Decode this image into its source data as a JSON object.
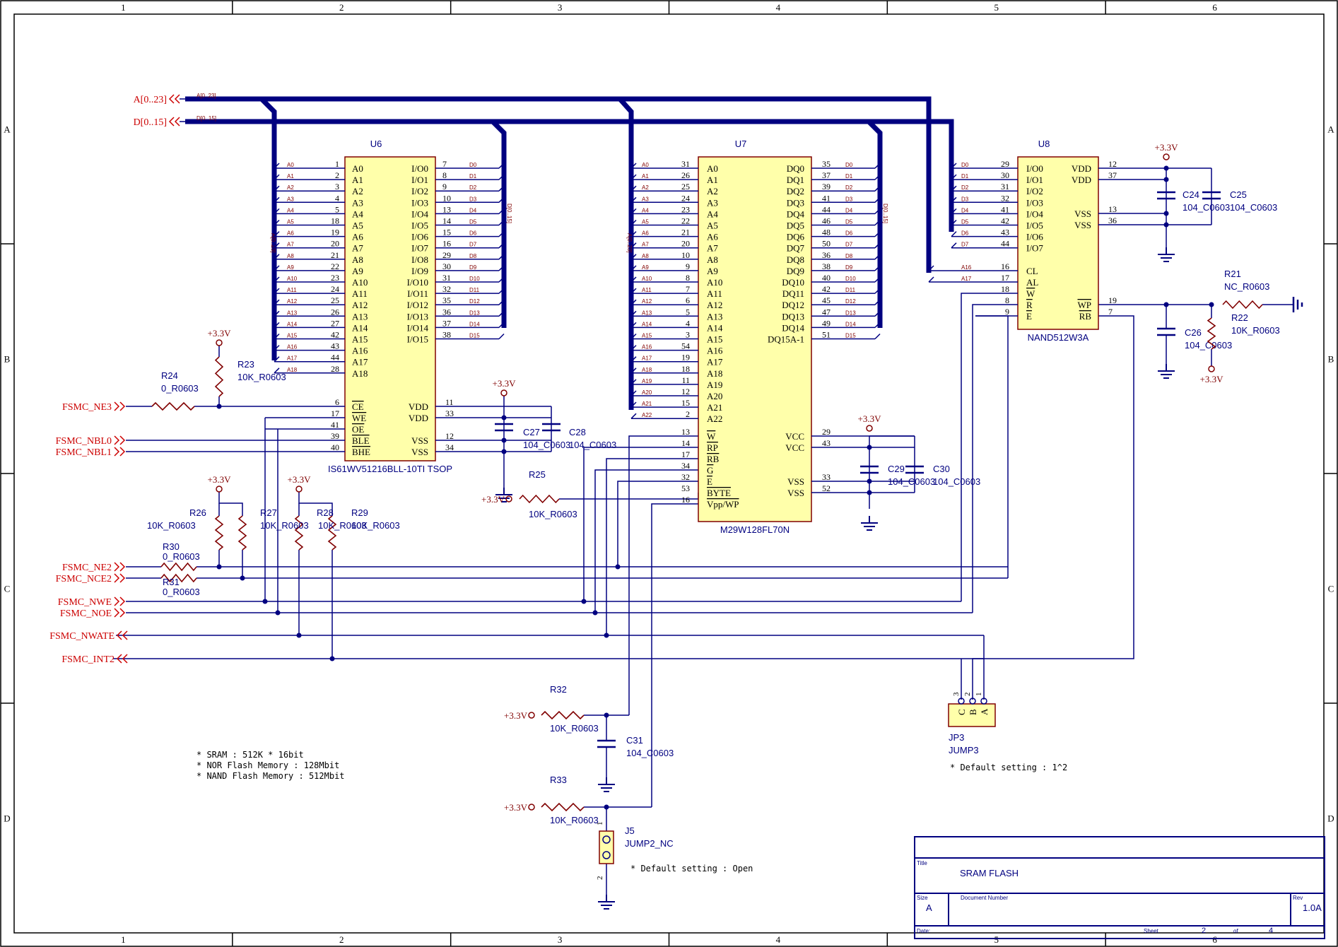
{
  "border": {
    "columns": [
      "1",
      "2",
      "3",
      "4",
      "5",
      "6"
    ],
    "rows": [
      "A",
      "B",
      "C",
      "D"
    ]
  },
  "ports": {
    "addr_bus": "A[0..23]",
    "data_bus": "D[0..15]",
    "addr_bus_label": "A[0..23]",
    "data_bus_label": "D[0..15]",
    "fsmc_ne3": "FSMC_NE3",
    "fsmc_nbl0": "FSMC_NBL0",
    "fsmc_nbl1": "FSMC_NBL1",
    "fsmc_ne2": "FSMC_NE2",
    "fsmc_nce2": "FSMC_NCE2",
    "fsmc_nwe": "FSMC_NWE",
    "fsmc_noe": "FSMC_NOE",
    "fsmc_nwait": "FSMC_NWATE",
    "fsmc_int2": "FSMC_INT2"
  },
  "u6": {
    "ref": "U6",
    "part": "IS61WV51216BLL-10TI TSOP",
    "bus_tag_addr": "A[0..23]",
    "bus_tag_data": "D[0..15]",
    "left_pins": [
      {
        "net": "A0",
        "num": "1",
        "name": "A0"
      },
      {
        "net": "A1",
        "num": "2",
        "name": "A1"
      },
      {
        "net": "A2",
        "num": "3",
        "name": "A2"
      },
      {
        "net": "A3",
        "num": "4",
        "name": "A3"
      },
      {
        "net": "A4",
        "num": "5",
        "name": "A4"
      },
      {
        "net": "A5",
        "num": "18",
        "name": "A5"
      },
      {
        "net": "A6",
        "num": "19",
        "name": "A6"
      },
      {
        "net": "A7",
        "num": "20",
        "name": "A7"
      },
      {
        "net": "A8",
        "num": "21",
        "name": "A8"
      },
      {
        "net": "A9",
        "num": "22",
        "name": "A9"
      },
      {
        "net": "A10",
        "num": "23",
        "name": "A10"
      },
      {
        "net": "A11",
        "num": "24",
        "name": "A11"
      },
      {
        "net": "A12",
        "num": "25",
        "name": "A12"
      },
      {
        "net": "A13",
        "num": "26",
        "name": "A13"
      },
      {
        "net": "A14",
        "num": "27",
        "name": "A14"
      },
      {
        "net": "A15",
        "num": "42",
        "name": "A15"
      },
      {
        "net": "A16",
        "num": "43",
        "name": "A16"
      },
      {
        "net": "A17",
        "num": "44",
        "name": "A17"
      },
      {
        "net": "A18",
        "num": "28",
        "name": "A18"
      }
    ],
    "ctrl_pins": [
      {
        "num": "6",
        "name": "CE"
      },
      {
        "num": "17",
        "name": "WE"
      },
      {
        "num": "41",
        "name": "OE"
      },
      {
        "num": "39",
        "name": "BLE"
      },
      {
        "num": "40",
        "name": "BHE"
      }
    ],
    "right_pins": [
      {
        "net": "D0",
        "num": "7",
        "name": "I/O0"
      },
      {
        "net": "D1",
        "num": "8",
        "name": "I/O1"
      },
      {
        "net": "D2",
        "num": "9",
        "name": "I/O2"
      },
      {
        "net": "D3",
        "num": "10",
        "name": "I/O3"
      },
      {
        "net": "D4",
        "num": "13",
        "name": "I/O4"
      },
      {
        "net": "D5",
        "num": "14",
        "name": "I/O5"
      },
      {
        "net": "D6",
        "num": "15",
        "name": "I/O6"
      },
      {
        "net": "D7",
        "num": "16",
        "name": "I/O7"
      },
      {
        "net": "D8",
        "num": "29",
        "name": "I/O8"
      },
      {
        "net": "D9",
        "num": "30",
        "name": "I/O9"
      },
      {
        "net": "D10",
        "num": "31",
        "name": "I/O10"
      },
      {
        "net": "D11",
        "num": "32",
        "name": "I/O11"
      },
      {
        "net": "D12",
        "num": "35",
        "name": "I/O12"
      },
      {
        "net": "D13",
        "num": "36",
        "name": "I/O13"
      },
      {
        "net": "D14",
        "num": "37",
        "name": "I/O14"
      },
      {
        "net": "D15",
        "num": "38",
        "name": "I/O15"
      }
    ],
    "power_pins": [
      {
        "num": "11",
        "name": "VDD"
      },
      {
        "num": "33",
        "name": "VDD"
      },
      {
        "num": "12",
        "name": "VSS"
      },
      {
        "num": "34",
        "name": "VSS"
      }
    ]
  },
  "u7": {
    "ref": "U7",
    "part": "M29W128FL70N",
    "bus_tag_addr": "A[0..23]",
    "bus_tag_data": "D[0..15]",
    "left_pins": [
      {
        "net": "A0",
        "num": "31",
        "name": "A0"
      },
      {
        "net": "A1",
        "num": "26",
        "name": "A1"
      },
      {
        "net": "A2",
        "num": "25",
        "name": "A2"
      },
      {
        "net": "A3",
        "num": "24",
        "name": "A3"
      },
      {
        "net": "A4",
        "num": "23",
        "name": "A4"
      },
      {
        "net": "A5",
        "num": "22",
        "name": "A5"
      },
      {
        "net": "A6",
        "num": "21",
        "name": "A6"
      },
      {
        "net": "A7",
        "num": "20",
        "name": "A7"
      },
      {
        "net": "A8",
        "num": "10",
        "name": "A8"
      },
      {
        "net": "A9",
        "num": "9",
        "name": "A9"
      },
      {
        "net": "A10",
        "num": "8",
        "name": "A10"
      },
      {
        "net": "A11",
        "num": "7",
        "name": "A11"
      },
      {
        "net": "A12",
        "num": "6",
        "name": "A12"
      },
      {
        "net": "A13",
        "num": "5",
        "name": "A13"
      },
      {
        "net": "A14",
        "num": "4",
        "name": "A14"
      },
      {
        "net": "A15",
        "num": "3",
        "name": "A15"
      },
      {
        "net": "A16",
        "num": "54",
        "name": "A16"
      },
      {
        "net": "A17",
        "num": "19",
        "name": "A17"
      },
      {
        "net": "A18",
        "num": "18",
        "name": "A18"
      },
      {
        "net": "A19",
        "num": "11",
        "name": "A19"
      },
      {
        "net": "A20",
        "num": "12",
        "name": "A20"
      },
      {
        "net": "A21",
        "num": "15",
        "name": "A21"
      },
      {
        "net": "A22",
        "num": "2",
        "name": "A22"
      }
    ],
    "ctrl_pins": [
      {
        "num": "13",
        "name": "W"
      },
      {
        "num": "14",
        "name": "RP"
      },
      {
        "num": "17",
        "name": "RB"
      },
      {
        "num": "34",
        "name": "G"
      },
      {
        "num": "32",
        "name": "E"
      },
      {
        "num": "53",
        "name": "BYTE"
      },
      {
        "num": "16",
        "name": "Vpp/WP"
      }
    ],
    "right_pins": [
      {
        "net": "D0",
        "num": "35",
        "name": "DQ0"
      },
      {
        "net": "D1",
        "num": "37",
        "name": "DQ1"
      },
      {
        "net": "D2",
        "num": "39",
        "name": "DQ2"
      },
      {
        "net": "D3",
        "num": "41",
        "name": "DQ3"
      },
      {
        "net": "D4",
        "num": "44",
        "name": "DQ4"
      },
      {
        "net": "D5",
        "num": "46",
        "name": "DQ5"
      },
      {
        "net": "D6",
        "num": "48",
        "name": "DQ6"
      },
      {
        "net": "D7",
        "num": "50",
        "name": "DQ7"
      },
      {
        "net": "D8",
        "num": "36",
        "name": "DQ8"
      },
      {
        "net": "D9",
        "num": "38",
        "name": "DQ9"
      },
      {
        "net": "D10",
        "num": "40",
        "name": "DQ10"
      },
      {
        "net": "D11",
        "num": "42",
        "name": "DQ11"
      },
      {
        "net": "D12",
        "num": "45",
        "name": "DQ12"
      },
      {
        "net": "D13",
        "num": "47",
        "name": "DQ13"
      },
      {
        "net": "D14",
        "num": "49",
        "name": "DQ14"
      },
      {
        "net": "D15",
        "num": "51",
        "name": "DQ15A-1"
      }
    ],
    "power_pins": [
      {
        "num": "29",
        "name": "VCC"
      },
      {
        "num": "43",
        "name": "VCC"
      },
      {
        "num": "33",
        "name": "VSS"
      },
      {
        "num": "52",
        "name": "VSS"
      }
    ]
  },
  "u8": {
    "ref": "U8",
    "part": "NAND512W3A",
    "left_pins": [
      {
        "net": "D0",
        "num": "29",
        "name": "I/O0"
      },
      {
        "net": "D1",
        "num": "30",
        "name": "I/O1"
      },
      {
        "net": "D2",
        "num": "31",
        "name": "I/O2"
      },
      {
        "net": "D3",
        "num": "32",
        "name": "I/O3"
      },
      {
        "net": "D4",
        "num": "41",
        "name": "I/O4"
      },
      {
        "net": "D5",
        "num": "42",
        "name": "I/O5"
      },
      {
        "net": "D6",
        "num": "43",
        "name": "I/O6"
      },
      {
        "net": "D7",
        "num": "44",
        "name": "I/O7"
      }
    ],
    "ctrl_pins": [
      {
        "net": "A16",
        "num": "16",
        "name": "CL"
      },
      {
        "net": "A17",
        "num": "17",
        "name": "AL"
      },
      {
        "net": "",
        "num": "18",
        "name": "W"
      },
      {
        "net": "",
        "num": "8",
        "name": "R"
      },
      {
        "net": "",
        "num": "9",
        "name": "E"
      }
    ],
    "right_pins": [
      {
        "num": "12",
        "name": "VDD"
      },
      {
        "num": "37",
        "name": "VDD"
      },
      {
        "num": "13",
        "name": "VSS"
      },
      {
        "num": "36",
        "name": "VSS"
      },
      {
        "num": "19",
        "name": "WP"
      },
      {
        "num": "7",
        "name": "RB"
      }
    ]
  },
  "passives": {
    "r21": {
      "ref": "R21",
      "val": "NC_R0603"
    },
    "r22": {
      "ref": "R22",
      "val": "10K_R0603"
    },
    "r23": {
      "ref": "R23",
      "val": "10K_R0603"
    },
    "r24": {
      "ref": "R24",
      "val": "0_R0603"
    },
    "r25": {
      "ref": "R25",
      "val": "10K_R0603"
    },
    "r26": {
      "ref": "R26",
      "val": "10K_R0603"
    },
    "r27": {
      "ref": "R27",
      "val": "10K_R0603"
    },
    "r28": {
      "ref": "R28",
      "val": "10K_R0603"
    },
    "r29": {
      "ref": "R29",
      "val": "10K_R0603"
    },
    "r30": {
      "ref": "R30",
      "val": "0_R0603"
    },
    "r31": {
      "ref": "R31",
      "val": "0_R0603"
    },
    "r32": {
      "ref": "R32",
      "val": "10K_R0603"
    },
    "r33": {
      "ref": "R33",
      "val": "10K_R0603"
    },
    "c24": {
      "ref": "C24",
      "val": "104_C0603"
    },
    "c25": {
      "ref": "C25",
      "val": "104_C0603"
    },
    "c26": {
      "ref": "C26",
      "val": "104_C0603"
    },
    "c27": {
      "ref": "C27",
      "val": "104_C0603"
    },
    "c28": {
      "ref": "C28",
      "val": "104_C0603"
    },
    "c29": {
      "ref": "C29",
      "val": "104_C0603"
    },
    "c30": {
      "ref": "C30",
      "val": "104_C0603"
    },
    "c31": {
      "ref": "C31",
      "val": "104_C0603"
    }
  },
  "supply": "+3.3V",
  "jp3": {
    "ref": "JP3",
    "val": "JUMP3",
    "pins": [
      "3",
      "2",
      "1"
    ],
    "letters": [
      "C",
      "B",
      "A"
    ]
  },
  "j5": {
    "ref": "J5",
    "val": "JUMP2_NC",
    "pins": [
      "1",
      "2"
    ]
  },
  "notes": {
    "memory": [
      "* SRAM : 512K * 16bit",
      "* NOR Flash Memory : 128Mbit",
      "* NAND Flash Memory : 512Mbit"
    ],
    "jp3_default": "* Default setting : 1^2",
    "j5_default": "* Default setting : Open"
  },
  "title_block": {
    "title_label": "Title",
    "title": "SRAM FLASH",
    "size_label": "Size",
    "size": "A",
    "docnum_label": "Document Number",
    "rev_label": "Rev",
    "rev": "1.0A",
    "date_label": "Date:",
    "sheet_label": "Sheet",
    "sheet": "2",
    "of_label": "of",
    "of": "4"
  },
  "colors": {
    "wire": "#000080",
    "bus": "#000080",
    "port": "#cc0000",
    "body_fill": "#ffffaa",
    "body_stroke": "#800000",
    "pin": "#800000",
    "net_label": "#800000",
    "supply": "#800000",
    "text": "#000080",
    "frame": "#000000"
  }
}
